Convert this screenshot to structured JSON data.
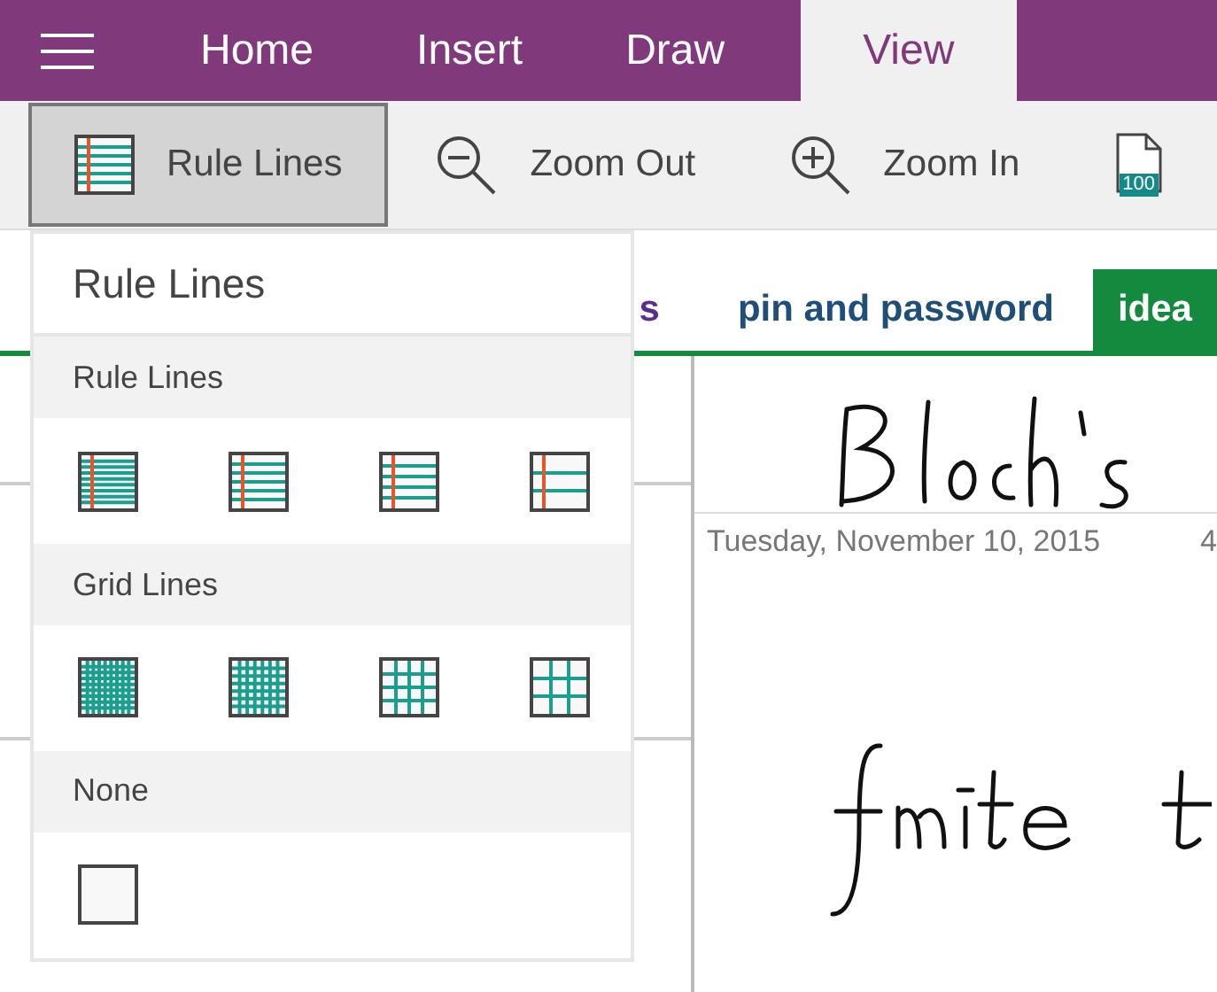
{
  "menu_tabs": [
    {
      "label": "Home",
      "selected": false
    },
    {
      "label": "Insert",
      "selected": false
    },
    {
      "label": "Draw",
      "selected": false
    },
    {
      "label": "View",
      "selected": true
    }
  ],
  "ribbon": [
    {
      "kind": "rule-lines",
      "label": "Rule Lines",
      "selected": true
    },
    {
      "kind": "zoom-out",
      "label": "Zoom Out",
      "selected": false
    },
    {
      "kind": "zoom-in",
      "label": "Zoom In",
      "selected": false
    },
    {
      "kind": "page-width",
      "badge": "100",
      "selected": false
    }
  ],
  "section_tabs": [
    {
      "label": "s",
      "color": "#5c2d91",
      "selected": false
    },
    {
      "label": "pin and password",
      "color": "#1f4e79",
      "selected": false
    },
    {
      "label": "idea",
      "color": "#138a3e",
      "selected": true
    }
  ],
  "page": {
    "date": "Tuesday, November 10, 2015",
    "time": "4"
  },
  "dropdown": {
    "title": "Rule Lines",
    "groups": [
      {
        "heading": "Rule Lines",
        "options": [
          {
            "kind": "rule"
          },
          {
            "kind": "rule"
          },
          {
            "kind": "rule"
          },
          {
            "kind": "rule"
          }
        ]
      },
      {
        "heading": "Grid Lines",
        "options": [
          {
            "kind": "grid"
          },
          {
            "kind": "grid"
          },
          {
            "kind": "grid"
          },
          {
            "kind": "grid"
          }
        ]
      },
      {
        "heading": "None",
        "options": [
          {
            "kind": "none"
          }
        ]
      }
    ]
  }
}
